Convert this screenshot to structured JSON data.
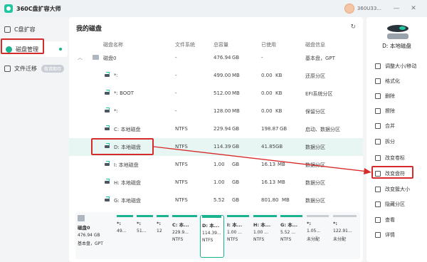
{
  "app": {
    "title": "360C盘扩容大师",
    "user": "360U33..."
  },
  "window": {
    "minimize": "—",
    "close": "✕"
  },
  "sidebar": {
    "items": [
      {
        "label": "C盘扩容"
      },
      {
        "label": "磁盘管理"
      },
      {
        "label": "文件迁移",
        "badge": "敬请期待"
      }
    ]
  },
  "main": {
    "title": "我的磁盘",
    "refresh": "↻",
    "columns": [
      "磁盘名称",
      "文件系统",
      "总容量",
      "已使用",
      "磁盘信息"
    ],
    "rows": [
      {
        "name": "磁盘0",
        "fs": "-",
        "total": "476.94",
        "unit": "GB",
        "used": "-",
        "used_unit": "",
        "info": "基本盘，GPT"
      },
      {
        "name": "*:",
        "fs": "-",
        "total": "499.00",
        "unit": "MB",
        "used": "0.00",
        "used_unit": "KB",
        "info": "还原分区"
      },
      {
        "name": "*: BOOT",
        "fs": "-",
        "total": "512.00",
        "unit": "MB",
        "used": "0.00",
        "used_unit": "KB",
        "info": "EFI系统分区"
      },
      {
        "name": "*:",
        "fs": "-",
        "total": "128.00",
        "unit": "MB",
        "used": "0.00",
        "used_unit": "KB",
        "info": "保留分区"
      },
      {
        "name": "C: 本地磁盘",
        "fs": "NTFS",
        "total": "229.94",
        "unit": "GB",
        "used": "198.87",
        "used_unit": "GB",
        "info": "启动、数据分区"
      },
      {
        "name": "D: 本地磁盘",
        "fs": "NTFS",
        "total": "114.39",
        "unit": "GB",
        "used": "41.85",
        "used_unit": "GB",
        "info": "数据分区"
      },
      {
        "name": "I: 本地磁盘",
        "fs": "NTFS",
        "total": "1.00",
        "unit": "GB",
        "used": "16.13",
        "used_unit": "MB",
        "info": "数据分区"
      },
      {
        "name": "H: 本地磁盘",
        "fs": "NTFS",
        "total": "1.00",
        "unit": "GB",
        "used": "16.13",
        "used_unit": "MB",
        "info": "数据分区"
      },
      {
        "name": "G: 本地磁盘",
        "fs": "NTFS",
        "total": "5.52",
        "unit": "GB",
        "used": "801.80",
        "used_unit": "MB",
        "info": "数据分区"
      }
    ]
  },
  "bottom": {
    "disk": {
      "name": "磁盘0",
      "size": "476.94 GB",
      "type": "基本盘，GPT"
    },
    "cards": [
      {
        "n": "*:",
        "s": "49...",
        "f": ""
      },
      {
        "n": "*:",
        "s": "51...",
        "f": ""
      },
      {
        "n": "*:",
        "s": "12",
        "f": ""
      },
      {
        "n": "C: 本...",
        "s": "229.9...",
        "f": "NTFS"
      },
      {
        "n": "D: 本...",
        "s": "114.39...",
        "f": "NTFS"
      },
      {
        "n": "I: 本...",
        "s": "1.00 ...",
        "f": "NTFS"
      },
      {
        "n": "H: 本...",
        "s": "1.00 ...",
        "f": "NTFS"
      },
      {
        "n": "G: 本...",
        "s": "5.52 ...",
        "f": "NTFS"
      },
      {
        "n": "*:",
        "s": "1.05...",
        "f": "未分配"
      },
      {
        "n": "*:",
        "s": "122.91...",
        "f": "未分配"
      }
    ]
  },
  "panel": {
    "disk_name": "D: 本地磁盘",
    "actions": [
      "调整大小/移动",
      "格式化",
      "删除",
      "擦除",
      "合并",
      "拆分",
      "改变卷标",
      "改变盘符",
      "改变簇大小",
      "隐藏分区",
      "查看",
      "详情"
    ]
  },
  "colors": {
    "accent": "#19b38f",
    "highlight": "#d62b2b"
  }
}
